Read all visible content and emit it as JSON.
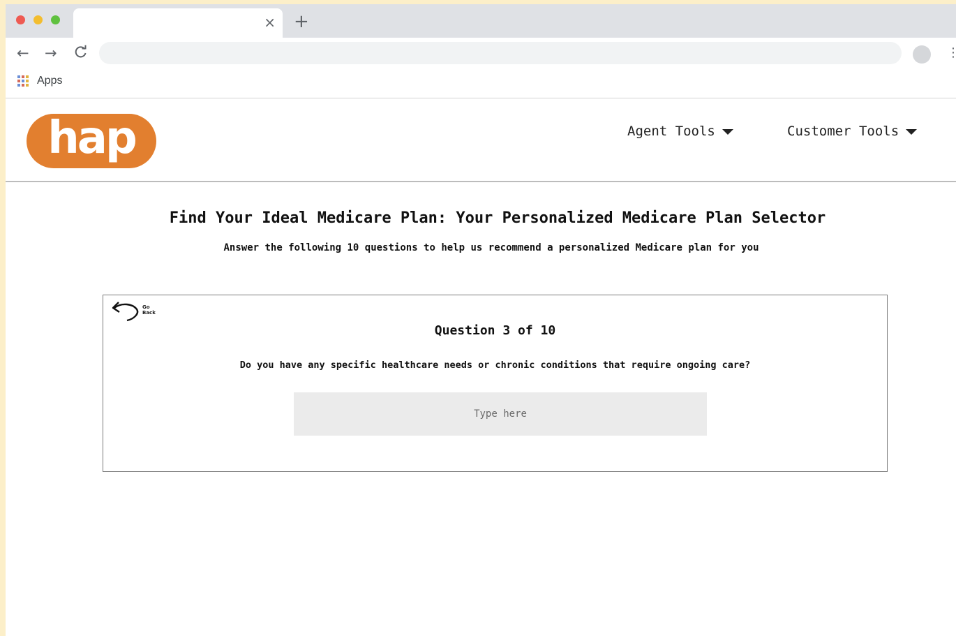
{
  "browser": {
    "tab": {
      "title": "",
      "close_glyph": "×"
    },
    "new_tab_glyph": "+",
    "nav": {
      "back_glyph": "←",
      "forward_glyph": "→",
      "reload_glyph": "C"
    },
    "address_bar": {
      "value": ""
    },
    "menu_glyph": "⋮",
    "bookmarks": {
      "apps_label": "Apps"
    }
  },
  "site": {
    "logo_text": "hap",
    "brand_color": "#e27f2f",
    "nav": [
      {
        "label": "Agent Tools"
      },
      {
        "label": "Customer Tools"
      }
    ]
  },
  "main": {
    "title": "Find Your Ideal Medicare Plan: Your Personalized Medicare Plan Selector",
    "subtitle": "Answer the following 10 questions to help us recommend a personalized Medicare plan for you",
    "question_card": {
      "go_back_label": "Go Back",
      "go_back_icon": "curved-back-arrow-icon",
      "progress": "Question 3 of 10",
      "question": "Do you have any specific healthcare needs or chronic conditions that require ongoing care?",
      "answer": {
        "value": "",
        "placeholder": "Type here"
      }
    }
  }
}
